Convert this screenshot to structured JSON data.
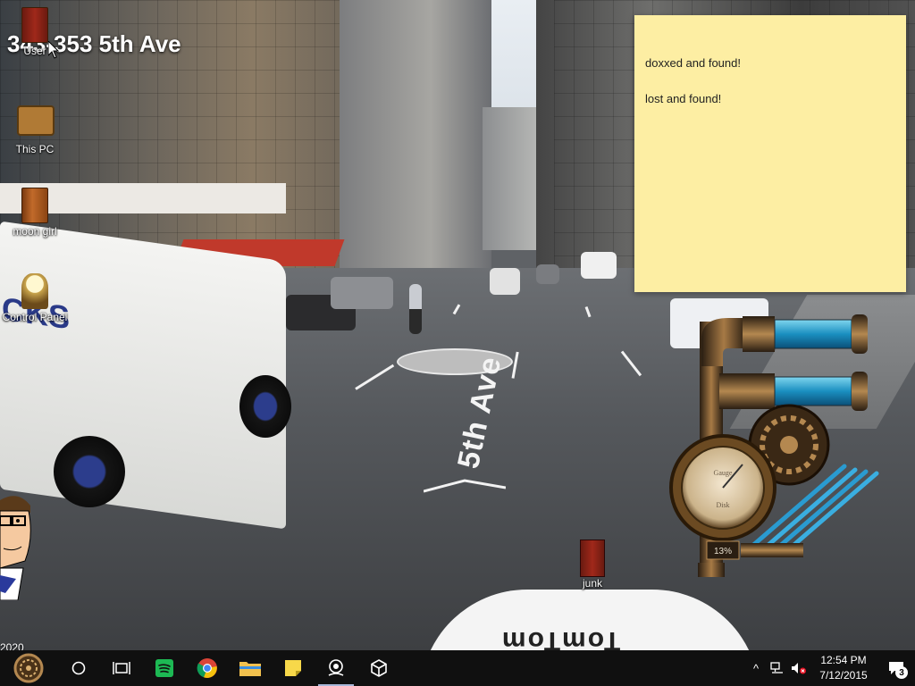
{
  "desktop": {
    "street_label": "343-353 5th Ave",
    "year_label": "2020",
    "road_marking": "5th Ave",
    "dashcam_brand": "TomTom",
    "icons": [
      {
        "name": "user",
        "label": "User"
      },
      {
        "name": "this-pc",
        "label": "This PC"
      },
      {
        "name": "moon-girl",
        "label": "moon girl"
      },
      {
        "name": "control-panel",
        "label": "Control Panel"
      },
      {
        "name": "junk",
        "label": "junk"
      }
    ]
  },
  "sticky_note": {
    "lines": [
      "doxxed and found!",
      "lost and found!"
    ],
    "color": "#fdeea3"
  },
  "gadget": {
    "gauge_label_top": "Gauge",
    "gauge_label_bottom": "Disk",
    "percent_readout": "13%"
  },
  "taskbar": {
    "pinned": [
      {
        "name": "start",
        "icon": "steampunk-orb-icon"
      },
      {
        "name": "search",
        "icon": "cortana-circle-icon"
      },
      {
        "name": "task-view",
        "icon": "task-view-icon"
      },
      {
        "name": "spotify",
        "icon": "spotify-icon",
        "color": "#1db954"
      },
      {
        "name": "chrome",
        "icon": "chrome-icon"
      },
      {
        "name": "file-explorer",
        "icon": "folder-icon",
        "color": "#f2c14e"
      },
      {
        "name": "sticky-notes",
        "icon": "sticky-notes-icon",
        "color": "#f7d84a"
      },
      {
        "name": "maps",
        "icon": "map-pin-icon"
      },
      {
        "name": "unity",
        "icon": "unity-icon"
      }
    ],
    "tray": {
      "chevron": "^",
      "time": "12:54 PM",
      "date": "7/12/2015",
      "notification_count": "3"
    }
  },
  "colors": {
    "taskbar_bg": "#101010",
    "active_underline": "#a6b6d8"
  }
}
